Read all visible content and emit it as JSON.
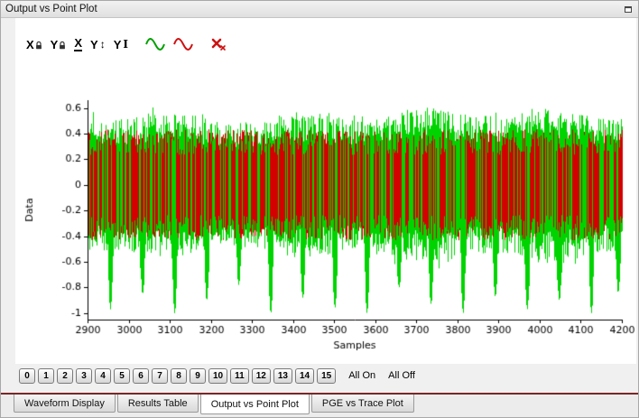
{
  "window": {
    "title": "Output vs Point Plot"
  },
  "toolbar": {
    "buttons": [
      {
        "name": "x-axis-lock",
        "text": "X",
        "adorn": "lock"
      },
      {
        "name": "y-axis-lock",
        "text": "Y",
        "adorn": "lock"
      },
      {
        "name": "x-axis-fixed",
        "text": "X",
        "adorn": "underline"
      },
      {
        "name": "y-axis-range",
        "text": "Y",
        "adorn": "updown",
        "arrow": "↕"
      },
      {
        "name": "y-cursor",
        "text": "Y",
        "adorn": "ibeam",
        "beam": "I"
      },
      {
        "name": "green-trace",
        "adorn": "wave",
        "color": "#00a000",
        "gap_before": true
      },
      {
        "name": "red-trace",
        "adorn": "wave",
        "color": "#cc1111"
      },
      {
        "name": "clear-traces",
        "adorn": "cross",
        "color": "#cc1111",
        "gap_before": true
      }
    ]
  },
  "chart_data": {
    "type": "line",
    "title": "",
    "xlabel": "Samples",
    "ylabel": "Data",
    "xlim": [
      2900,
      4200
    ],
    "ylim": [
      -1.05,
      0.66
    ],
    "x_tick_values": [
      2900,
      3000,
      3100,
      3200,
      3300,
      3400,
      3500,
      3600,
      3700,
      3800,
      3900,
      4000,
      4100,
      4200
    ],
    "x_tick_labels": [
      "2900",
      "3000",
      "3100",
      "3200",
      "3300",
      "3400",
      "3500",
      "3600",
      "3700",
      "3800",
      "3900",
      "4000",
      "4100",
      "4200"
    ],
    "y_tick_values": [
      0.6,
      0.4,
      0.2,
      0,
      -0.2,
      -0.4,
      -0.6,
      -0.8,
      -1
    ],
    "y_tick_labels": [
      "0.6",
      "0.4",
      "0.2",
      "0",
      "-0.2",
      "-0.4",
      "-0.6",
      "-0.8",
      "-1"
    ],
    "grid": false,
    "legend": null,
    "series": [
      {
        "name": "green-output-noise",
        "color": "#00d400",
        "band_typical": [
          -0.45,
          0.45
        ],
        "band_max": [
          -0.55,
          0.55
        ],
        "has_negative_spikes": true
      },
      {
        "name": "red-output-noise",
        "color": "#d40000",
        "band_typical": [
          -0.36,
          0.36
        ],
        "band_max": [
          -0.43,
          0.43
        ],
        "has_negative_spikes": false
      }
    ],
    "negative_spikes": [
      {
        "x": 2955,
        "depth": -0.97
      },
      {
        "x": 3033,
        "depth": -0.85
      },
      {
        "x": 3111,
        "depth": -1.0
      },
      {
        "x": 3189,
        "depth": -0.9
      },
      {
        "x": 3267,
        "depth": -0.78
      },
      {
        "x": 3345,
        "depth": -1.0
      },
      {
        "x": 3423,
        "depth": -0.88
      },
      {
        "x": 3501,
        "depth": -0.96
      },
      {
        "x": 3579,
        "depth": -1.0
      },
      {
        "x": 3657,
        "depth": -0.8
      },
      {
        "x": 3735,
        "depth": -0.93
      },
      {
        "x": 3813,
        "depth": -1.0
      },
      {
        "x": 3891,
        "depth": -0.87
      },
      {
        "x": 3969,
        "depth": -0.97
      },
      {
        "x": 4047,
        "depth": -0.9
      },
      {
        "x": 4125,
        "depth": -1.0
      },
      {
        "x": 4190,
        "depth": -0.84
      }
    ]
  },
  "channels": {
    "buttons": [
      "0",
      "1",
      "2",
      "3",
      "4",
      "5",
      "6",
      "7",
      "8",
      "9",
      "10",
      "11",
      "12",
      "13",
      "14",
      "15"
    ],
    "all_on_label": "All On",
    "all_off_label": "All Off"
  },
  "tabs": {
    "items": [
      {
        "label": "Waveform Display",
        "active": false
      },
      {
        "label": "Results Table",
        "active": false
      },
      {
        "label": "Output vs Point Plot",
        "active": true
      },
      {
        "label": "PGE vs Trace Plot",
        "active": false
      }
    ]
  }
}
